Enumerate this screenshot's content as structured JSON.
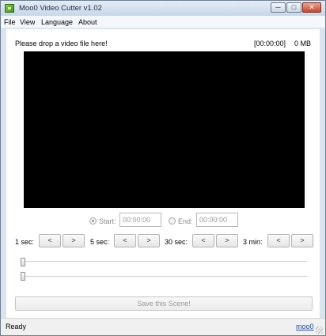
{
  "window": {
    "title": "Moo0 Video Cutter v1.02",
    "icon": "app-logo-icon",
    "controls": {
      "minimize": "─",
      "maximize": "□",
      "close": "✕"
    }
  },
  "menu": {
    "file": "File",
    "view": "View",
    "language": "Language",
    "about": "About"
  },
  "header": {
    "drop_hint": "Please drop a video file here!",
    "time": "[00:00:00]",
    "size": "0 MB"
  },
  "range": {
    "start_label": "Start:",
    "start_value": "00:00:00",
    "end_label": "End:",
    "end_value": "00:00:00",
    "selected": "start"
  },
  "seek": {
    "groups": [
      {
        "label": "1 sec:"
      },
      {
        "label": "5 sec:"
      },
      {
        "label": "30 sec:"
      },
      {
        "label": "3 min:"
      }
    ],
    "back": "<",
    "forward": ">"
  },
  "actions": {
    "save": "Save this Scene!"
  },
  "status": {
    "text": "Ready",
    "link": "moo0"
  },
  "colors": {
    "video_bg": "#000000",
    "window_frame": "#d9e4ef",
    "close_button": "#c8432c",
    "link": "#1b4aa3"
  }
}
